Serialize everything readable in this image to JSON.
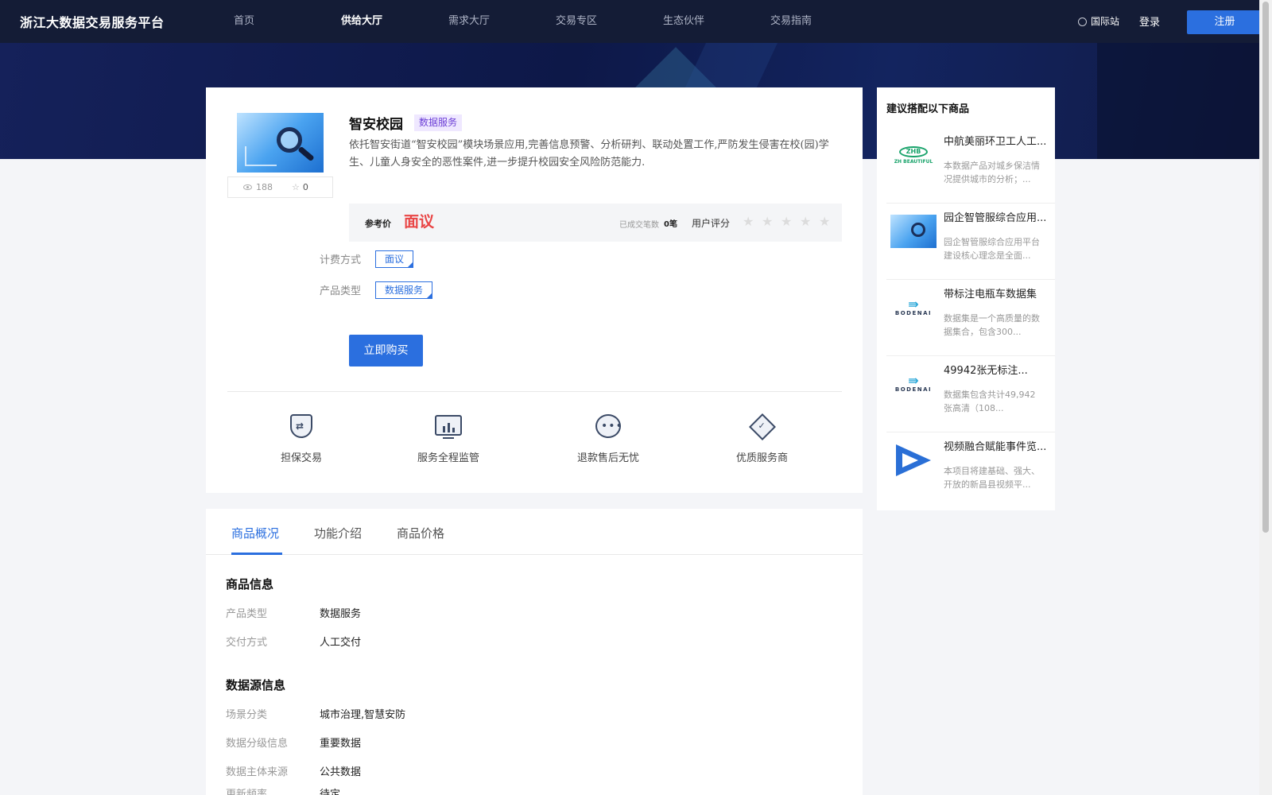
{
  "header": {
    "logo": "浙江大数据交易服务平台",
    "nav": [
      "首页",
      "供给大厅",
      "需求大厅",
      "交易专区",
      "生态伙伴",
      "交易指南"
    ],
    "active_nav": "供给大厅",
    "intl": "国际站",
    "login": "登录",
    "register": "注册"
  },
  "product": {
    "title": "智安校园",
    "tag": "数据服务",
    "description": "依托智安街道“智安校园”模块场景应用,完善信息预警、分析研判、联动处置工作,严防发生侵害在校(园)学生、儿童人身安全的恶性案件,进一步提升校园安全风险防范能力.",
    "views": "188",
    "favorites": "0",
    "price_label": "参考价",
    "price": "面议",
    "deals_label": "已成交笔数",
    "deals_value": "0笔",
    "rating_label": "用户评分",
    "rating_stars": 0,
    "billing_label": "计费方式",
    "billing_value": "面议",
    "ptype_label": "产品类型",
    "ptype_value": "数据服务",
    "buy_button": "立即购买"
  },
  "features": [
    {
      "label": "担保交易",
      "icon": "shield-exchange-icon"
    },
    {
      "label": "服务全程监管",
      "icon": "monitor-chart-icon"
    },
    {
      "label": "退款售后无忧",
      "icon": "chat-bubble-icon"
    },
    {
      "label": "优质服务商",
      "icon": "diamond-icon"
    }
  ],
  "sidebar": {
    "title": "建议搭配以下商品",
    "items": [
      {
        "name": "中航美丽环卫工人工...",
        "desc": "本数据产品对城乡保洁情况提供城市的分析；...",
        "logo": "ZHB",
        "logo_sub": "ZH BEAUTIFUL"
      },
      {
        "name": "园企智管服综合应用...",
        "desc": "园企智管服综合应用平台建设核心理念是全面...",
        "logo": "",
        "logo_sub": ""
      },
      {
        "name": "带标注电瓶车数据集",
        "desc": "数据集是一个高质量的数据集合，包含300...",
        "logo": "BODENAI",
        "logo_sub": ""
      },
      {
        "name": "49942张无标注...",
        "desc": "数据集包含共计49,942张高清（108...",
        "logo": "BODENAI",
        "logo_sub": ""
      },
      {
        "name": "视频融合赋能事件览...",
        "desc": "本项目将建基础、强大、开放的新昌县视频平...",
        "logo": "",
        "logo_sub": ""
      }
    ]
  },
  "detail": {
    "tabs": [
      "商品概况",
      "功能介绍",
      "商品价格"
    ],
    "active_tab": "商品概况",
    "sections": [
      {
        "title": "商品信息",
        "rows": [
          {
            "key": "产品类型",
            "value": "数据服务"
          },
          {
            "key": "交付方式",
            "value": "人工交付"
          }
        ]
      },
      {
        "title": "数据源信息",
        "rows": [
          {
            "key": "场景分类",
            "value": "城市治理,智慧安防"
          },
          {
            "key": "数据分级信息",
            "value": "重要数据"
          },
          {
            "key": "数据主体来源",
            "value": "公共数据"
          },
          {
            "key": "更新频率",
            "value": "待定"
          }
        ]
      }
    ]
  },
  "colors": {
    "header_bg": "#141c36",
    "accent": "#2b6fdf",
    "price": "#e94545",
    "tag_bg": "#efe8ff",
    "tag_text": "#6c3fd6"
  }
}
